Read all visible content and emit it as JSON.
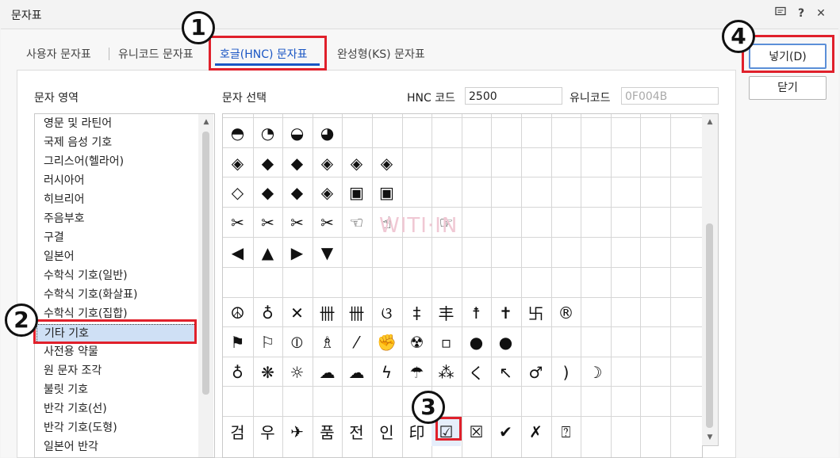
{
  "window": {
    "title": "문자표",
    "icons": [
      "comment-icon",
      "help-icon",
      "close-icon"
    ],
    "help_label": "?",
    "close_label": "✕"
  },
  "tabs": [
    {
      "label": "사용자 문자표"
    },
    {
      "label": "유니코드 문자표"
    },
    {
      "label": "호글(HNC) 문자표",
      "active": true
    },
    {
      "label": "완성형(KS) 문자표"
    }
  ],
  "left": {
    "header": "문자 영역",
    "items": [
      "영문 및 라틴어",
      "국제 음성 기호",
      "그리스어(헬라어)",
      "러시아어",
      "히브리어",
      "주음부호",
      "구결",
      "일본어",
      "수학식 기호(일반)",
      "수학식 기호(화살표)",
      "수학식 기호(집합)",
      "기타 기호",
      "사전용 약물",
      "원 문자 조각",
      "불릿 기호",
      "반각 기호(선)",
      "반각 기호(도형)",
      "일본어 반각"
    ],
    "selected_index": 11
  },
  "right": {
    "header": "문자 선택",
    "hnc_code_label": "HNC 코드",
    "hnc_code_value": "2500",
    "unicode_label": "유니코드",
    "unicode_value": "0F004B"
  },
  "grid": {
    "rows": [
      [
        "◓",
        "◔",
        "◒",
        "◕",
        "",
        "",
        "",
        "",
        "",
        "",
        "",
        "",
        "",
        "",
        "",
        ""
      ],
      [
        "◈",
        "◆",
        "◆",
        "◈",
        "◈",
        "◈",
        "",
        "",
        "",
        "",
        "",
        "",
        "",
        "",
        "",
        ""
      ],
      [
        "◇",
        "◆",
        "◆",
        "◈",
        "▣",
        "▣",
        "",
        "",
        "",
        "",
        "",
        "",
        "",
        "",
        "",
        ""
      ],
      [
        "✂",
        "✂",
        "✂",
        "✂",
        "☜",
        "☝",
        "",
        "☞",
        "",
        "",
        "",
        "",
        "",
        "",
        "",
        ""
      ],
      [
        "◀",
        "▲",
        "▶",
        "▼",
        "",
        "",
        "",
        "",
        "",
        "",
        "",
        "",
        "",
        "",
        "",
        ""
      ],
      [
        "",
        "",
        "",
        "",
        "",
        "",
        "",
        "",
        "",
        "",
        "",
        "",
        "",
        "",
        "",
        ""
      ],
      [
        "☮",
        "♁",
        "✕",
        "卌",
        "卌",
        "ଓ",
        "‡",
        "丰",
        "☨",
        "✝",
        "卐",
        "®",
        "",
        "",
        "",
        ""
      ],
      [
        "⚑",
        "⚐",
        "⦶",
        "♗",
        "⁄",
        "✊",
        "☢",
        "▫",
        "●",
        "●",
        "",
        "",
        "",
        "",
        "",
        ""
      ],
      [
        "♁",
        "❋",
        "☼",
        "☁",
        "☁",
        "ϟ",
        "☂",
        "⁂",
        "く",
        "↖",
        "♂",
        ")",
        "☽",
        "",
        "",
        ""
      ],
      [
        "",
        "",
        "",
        "",
        "",
        "",
        "",
        "",
        "",
        "",
        "",
        "",
        "",
        "",
        "",
        ""
      ],
      [
        "검",
        "우",
        "✈",
        "품",
        "전",
        "인",
        "印",
        "☑",
        "☒",
        "✔",
        "✗",
        "⍰",
        "",
        "",
        "",
        ""
      ]
    ],
    "selected": {
      "row": 10,
      "col": 7
    }
  },
  "watermark": "WITI·IN",
  "buttons": {
    "insert_label": "넣기(D)",
    "close_label": "닫기"
  },
  "annotations": [
    "1",
    "2",
    "3",
    "4"
  ]
}
